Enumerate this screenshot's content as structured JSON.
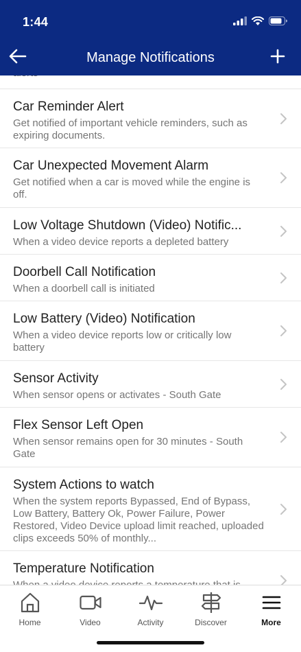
{
  "status_bar": {
    "time": "1:44"
  },
  "nav": {
    "title": "Manage Notifications"
  },
  "partial_top_text": "alerts",
  "notifications": [
    {
      "title": "Car Reminder Alert",
      "description": "Get notified of important vehicle reminders, such as expiring documents."
    },
    {
      "title": "Car Unexpected Movement Alarm",
      "description": "Get notified when a car is moved while the engine is off."
    },
    {
      "title": "Low Voltage Shutdown (Video) Notific...",
      "description": "When a video device reports a depleted battery"
    },
    {
      "title": "Doorbell Call Notification",
      "description": "When a doorbell call is initiated"
    },
    {
      "title": "Low Battery (Video) Notification",
      "description": "When a video device reports low or critically low battery"
    },
    {
      "title": "Sensor Activity",
      "description": "When sensor opens or activates - South Gate"
    },
    {
      "title": "Flex Sensor Left Open",
      "description": "When sensor remains open for 30 minutes - South Gate"
    },
    {
      "title": "System Actions to watch",
      "description": "When the system reports Bypassed, End of Bypass, Low Battery, Battery Ok, Power Failure, Power Restored, Video Device upload limit reached, uploaded clips exceeds 50% of monthly..."
    },
    {
      "title": "Temperature Notification",
      "description": "When a video device reports a temperature that is"
    }
  ],
  "tabs": [
    {
      "label": "Home",
      "icon": "home-icon"
    },
    {
      "label": "Video",
      "icon": "video-camera-icon"
    },
    {
      "label": "Activity",
      "icon": "activity-pulse-icon"
    },
    {
      "label": "Discover",
      "icon": "signpost-icon"
    },
    {
      "label": "More",
      "icon": "menu-icon"
    }
  ],
  "active_tab": "More",
  "colors": {
    "header_bg": "#0c2a82",
    "accent": "#0c2a82"
  }
}
